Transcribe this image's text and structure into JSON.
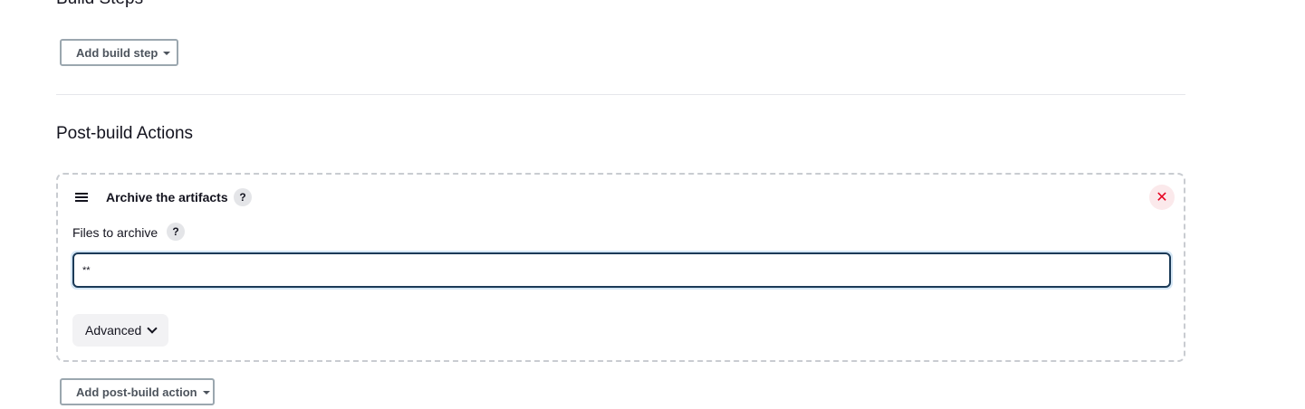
{
  "build_steps": {
    "heading": "Build Steps",
    "add_button_label": "Add build step"
  },
  "post_build": {
    "heading": "Post-build Actions",
    "add_button_label": "Add post-build action",
    "action": {
      "title": "Archive the artifacts",
      "help_label": "?",
      "close_label": "✕",
      "files_field": {
        "label": "Files to archive",
        "help_label": "?",
        "value": "**"
      },
      "advanced_label": "Advanced"
    }
  },
  "colors": {
    "accent": "#1b3a57",
    "close": "#e6001f"
  },
  "icons": {
    "drag": "drag-handle-icon",
    "help": "help-icon",
    "close": "close-icon",
    "caret": "caret-down-icon",
    "chevron": "chevron-down-icon"
  }
}
